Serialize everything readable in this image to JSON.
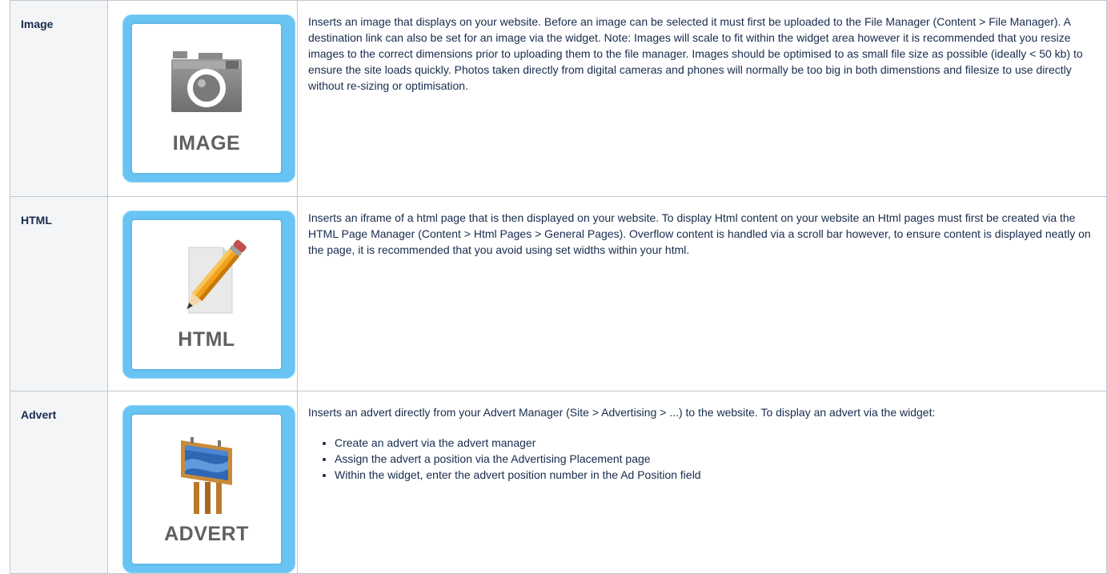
{
  "rows": [
    {
      "name": "Image",
      "icon": "camera-icon",
      "tile_label": "IMAGE",
      "description": "Inserts an image that displays on your website. Before an image can be selected it must first be uploaded to the File Manager (Content > File Manager). A destination link can also be set for an image via the widget. Note: Images will scale to fit within the widget area however it is recommended that you resize images to the correct dimensions prior to uploading them to the file manager. Images should be optimised to as small file size as possible (ideally < 50 kb) to ensure the site loads quickly. Photos taken directly from digital cameras and phones will normally be too big in both dimenstions and filesize to use directly without re-sizing or optimisation."
    },
    {
      "name": "HTML",
      "icon": "pencil-icon",
      "tile_label": "HTML",
      "description": "Inserts an iframe of a html page that is then displayed on your website. To display Html content on your website an Html pages must first be created via the HTML Page Manager (Content > Html Pages > General Pages). Overflow content is handled via a scroll bar however, to ensure content is displayed neatly on the page, it is recommended that you avoid using set widths within your html."
    },
    {
      "name": "Advert",
      "icon": "billboard-icon",
      "tile_label": "ADVERT",
      "description": "Inserts an advert directly from your Advert Manager (Site > Advertising > ...) to the website. To display an advert via the widget:",
      "steps": [
        "Create an advert via the advert manager",
        "Assign the advert a position via the Advertising Placement page",
        "Within the widget, enter the advert position number in the Ad Position field"
      ]
    }
  ],
  "colors": {
    "tile_frame": "#68c4f3",
    "label_gray": "#606060",
    "border": "#c1c7d0",
    "header_cell_bg": "#f4f5f7"
  }
}
